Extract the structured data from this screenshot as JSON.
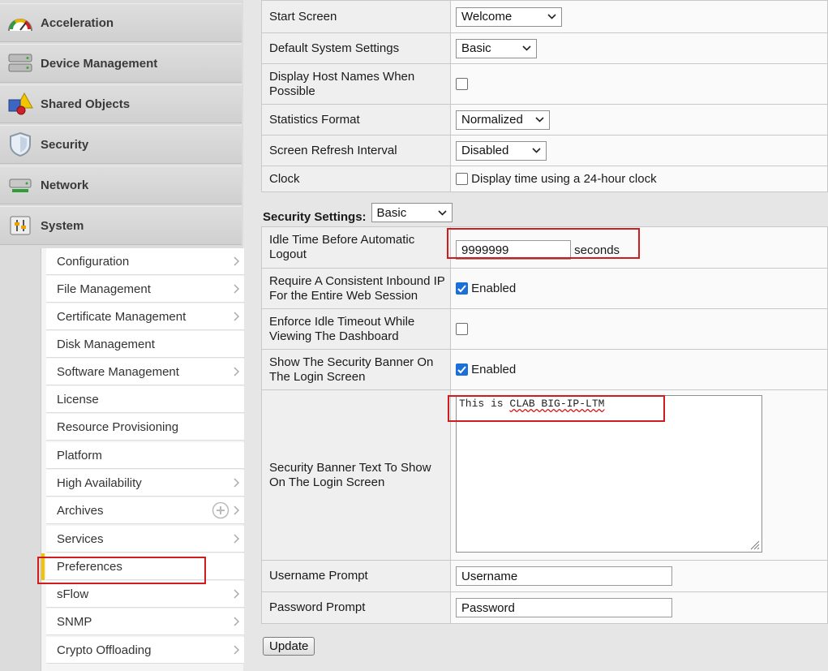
{
  "sidebar": {
    "sections": [
      {
        "label": "Acceleration",
        "icon": "gauge-icon"
      },
      {
        "label": "Device Management",
        "icon": "server-rack-icon"
      },
      {
        "label": "Shared Objects",
        "icon": "shapes-icon"
      },
      {
        "label": "Security",
        "icon": "shield-icon"
      },
      {
        "label": "Network",
        "icon": "network-device-icon"
      },
      {
        "label": "System",
        "icon": "system-settings-icon"
      }
    ],
    "submenu": [
      {
        "label": "Configuration"
      },
      {
        "label": "File Management"
      },
      {
        "label": "Certificate Management"
      },
      {
        "label": "Disk Management"
      },
      {
        "label": "Software Management"
      },
      {
        "label": "License"
      },
      {
        "label": "Resource Provisioning"
      },
      {
        "label": "Platform"
      },
      {
        "label": "High Availability"
      },
      {
        "label": "Archives"
      },
      {
        "label": "Services"
      },
      {
        "label": "Preferences"
      },
      {
        "label": "sFlow"
      },
      {
        "label": "SNMP"
      },
      {
        "label": "Crypto Offloading"
      }
    ],
    "active_item": "Preferences"
  },
  "general": {
    "start_screen": {
      "label": "Start Screen",
      "value": "Welcome"
    },
    "default_system_settings": {
      "label": "Default System Settings",
      "value": "Basic"
    },
    "display_host_names": {
      "label": "Display Host Names When Possible",
      "checked": false
    },
    "statistics_format": {
      "label": "Statistics Format",
      "value": "Normalized"
    },
    "screen_refresh_interval": {
      "label": "Screen Refresh Interval",
      "value": "Disabled"
    },
    "clock": {
      "label": "Clock",
      "checkbox_label": "Display time using a 24-hour clock",
      "checked": false
    }
  },
  "security": {
    "header_label": "Security Settings:",
    "mode": "Basic",
    "idle_time": {
      "label": "Idle Time Before Automatic Logout",
      "value": "9999999",
      "unit": "seconds"
    },
    "consistent_ip": {
      "label": "Require A Consistent Inbound IP For the Entire Web Session",
      "checked": true,
      "checkbox_label": "Enabled"
    },
    "enforce_idle_timeout": {
      "label": "Enforce Idle Timeout While Viewing The Dashboard",
      "checked": false
    },
    "show_banner": {
      "label": "Show The Security Banner On The Login Screen",
      "checked": true,
      "checkbox_label": "Enabled"
    },
    "banner_text": {
      "label": "Security Banner Text To Show On The Login Screen",
      "prefix": "This is",
      "flagged_words": "CLAB BIG-IP-LTM"
    },
    "username_prompt": {
      "label": "Username Prompt",
      "value": "Username"
    },
    "password_prompt": {
      "label": "Password Prompt",
      "value": "Password"
    }
  },
  "actions": {
    "update_label": "Update"
  },
  "colors": {
    "highlight": "#d01c1c",
    "checkbox_on": "#1a6fd8",
    "active_marker": "#f5c200"
  }
}
